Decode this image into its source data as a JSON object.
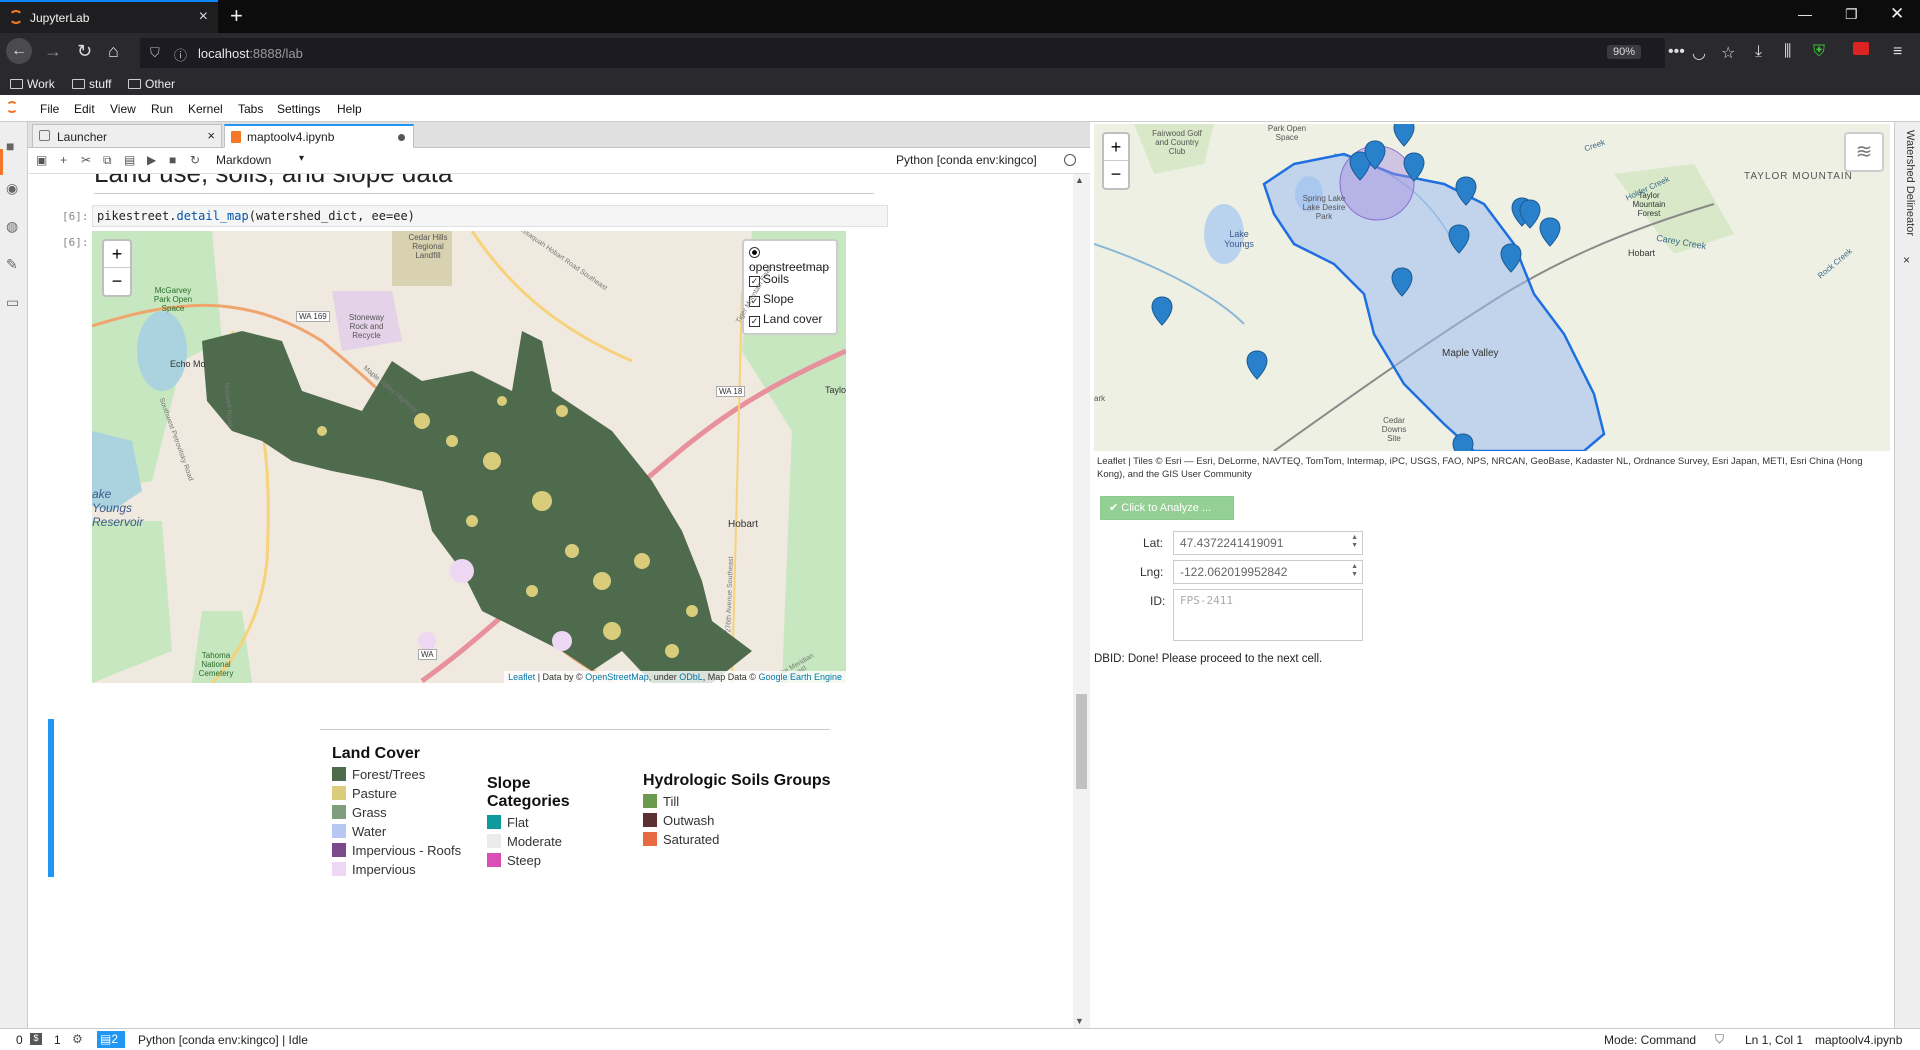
{
  "browser": {
    "tab_title": "JupyterLab",
    "new_tab": "+",
    "url_host": "localhost",
    "url_rest": ":8888/lab",
    "zoom": "90%",
    "bookmarks": [
      "Work",
      "stuff",
      "Other"
    ]
  },
  "menu": [
    "File",
    "Edit",
    "View",
    "Run",
    "Kernel",
    "Tabs",
    "Settings",
    "Help"
  ],
  "doc_tabs": [
    {
      "label": "Launcher"
    },
    {
      "label": "maptoolv4.ipynb"
    }
  ],
  "toolbar": {
    "cell_type": "Markdown",
    "kernel": "Python [conda env:kingco]"
  },
  "notebook": {
    "heading": "Land use, soils, and slope data",
    "in_prompt": "[6]:",
    "out_prompt": "[6]:",
    "code": {
      "obj": "pikestreet",
      "dot": ".",
      "fn": "detail_map",
      "args": "(watershed_dict, ee=ee)"
    },
    "map": {
      "layers": {
        "base": "openstreetmap",
        "overlays": [
          {
            "label": "Soils",
            "checked": true
          },
          {
            "label": "Slope",
            "checked": true
          },
          {
            "label": "Land cover",
            "checked": true
          }
        ]
      },
      "place_labels": [
        "Cedar Hills Regional Landfill",
        "McGarvey Park Open Space",
        "Stoneway Rock and Recycle",
        "Echo Mo",
        "ake Youngs Reservoir",
        "Hobart",
        "Taylo",
        "Tahoma National Cemetery",
        "WA 169",
        "WA 18",
        "WA",
        "Maple Valley Highway",
        "Southwest Petrovitsky Road",
        "Maxwell Road",
        "Issaquah Hobart Road Southeast",
        "Tiger Mountain Road",
        "276th Avenue Southeast",
        "Lake Meridian Southeast"
      ],
      "attribution": {
        "leaflet": "Leaflet",
        "t1": " | Data by © ",
        "osm": "OpenStreetMap",
        "t2": ", under ",
        "odbl": "ODbL",
        "t3": ", Map Data © ",
        "gee": "Google Earth Engine"
      }
    },
    "legend": {
      "land_cover": {
        "title": "Land Cover",
        "items": [
          {
            "label": "Forest/Trees",
            "color": "#4e6b4e"
          },
          {
            "label": "Pasture",
            "color": "#d9cd7c"
          },
          {
            "label": "Grass",
            "color": "#7e9e7e"
          },
          {
            "label": "Water",
            "color": "#b6c8f2"
          },
          {
            "label": "Impervious - Roofs",
            "color": "#7a4a8a"
          },
          {
            "label": "Impervious",
            "color": "#eed7f2"
          }
        ]
      },
      "slope": {
        "title": "Slope Categories",
        "items": [
          {
            "label": "Flat",
            "color": "#0f9a9e"
          },
          {
            "label": "Moderate",
            "color": "#ebebeb"
          },
          {
            "label": "Steep",
            "color": "#d94fb5"
          }
        ]
      },
      "soils": {
        "title": "Hydrologic Soils Groups",
        "items": [
          {
            "label": "Till",
            "color": "#6a9a4e"
          },
          {
            "label": "Outwash",
            "color": "#5a3030"
          },
          {
            "label": "Saturated",
            "color": "#e86a40"
          }
        ]
      }
    }
  },
  "right_panel": {
    "map_labels": [
      "Fairwood Golf and Country Club",
      "Park Open Space",
      "Spring Lake Lake Desire Park",
      "Lake Youngs",
      "Maple Valley",
      "Taylor Mountain Forest",
      "TAYLOR MOUNTAIN",
      "Carey Creek",
      "Holder Creek",
      "Rock Creek",
      "Hobart",
      "Cedar Downs Site",
      "Creek",
      "ark"
    ],
    "attribution": "Leaflet | Tiles © Esri — Esri, DeLorme, NAVTEQ, TomTom, Intermap, iPC, USGS, FAO, NPS, NRCAN, GeoBase, Kadaster NL, Ordnance Survey, Esri Japan, METI, Esri China (Hong Kong), and the GIS User Community",
    "analyze_button": "Click to Analyze ...",
    "lat_label": "Lat:",
    "lat_value": "47.4372241419091",
    "lng_label": "Lng:",
    "lng_value": "-122.062019952842",
    "id_label": "ID:",
    "id_placeholder": "FPS-2411",
    "output": "DBID: Done! Please proceed to the next cell.",
    "side_tab": "Watershed Delineator"
  },
  "status": {
    "n0": "0",
    "n1": "1",
    "n2": "2",
    "kernel": "Python [conda env:kingco] | Idle",
    "mode": "Mode: Command",
    "pos": "Ln 1, Col 1",
    "file": "maptoolv4.ipynb"
  },
  "colors": {
    "accent": "#0a84ff",
    "jupyter_orange": "#f37726",
    "forest": "#4e6b4e",
    "pasture": "#d9cd7c",
    "watershed_fill": "#9dbdf0",
    "watershed_line": "#1f6fe0",
    "pin": "#2a81cb",
    "analyze_green": "#5cb85c"
  }
}
